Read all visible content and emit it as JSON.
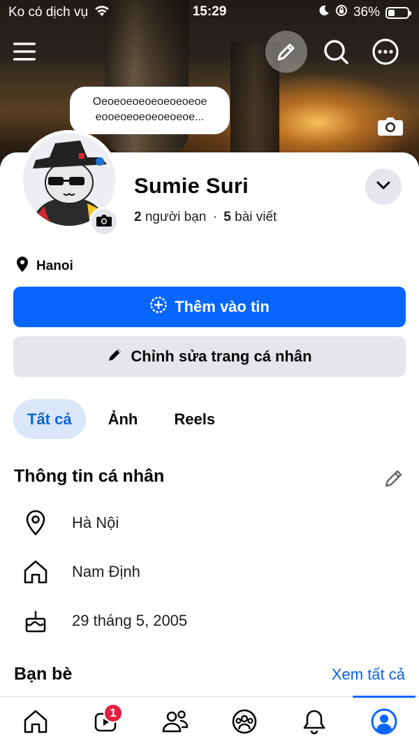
{
  "status_bar": {
    "carrier": "Ko có dịch vụ",
    "time": "15:29",
    "battery_percent_label": "36%",
    "battery_level": 0.36,
    "icons": [
      "wifi-icon",
      "moon-icon",
      "orientation-lock-icon",
      "battery-icon"
    ]
  },
  "header": {
    "icons": [
      "menu-icon",
      "pencil-icon",
      "search-icon",
      "more-icon"
    ]
  },
  "note_bubble": {
    "line1": "Oeoeoeoeoeoeoeoeoe",
    "line2": "eooeoeoeoeoeoeoe..."
  },
  "profile": {
    "name": "Sumie Suri",
    "friends_count": "2",
    "friends_label": "người bạn",
    "separator": "·",
    "posts_count": "5",
    "posts_label": "bài viết",
    "location": "Hanoi"
  },
  "actions": {
    "add_to_story": "Thêm vào tin",
    "edit_profile": "Chỉnh sửa trang cá nhân"
  },
  "tabs": [
    {
      "label": "Tất cả",
      "active": true
    },
    {
      "label": "Ảnh",
      "active": false
    },
    {
      "label": "Reels",
      "active": false
    }
  ],
  "personal_info": {
    "title": "Thông tin cá nhân",
    "rows": [
      {
        "icon": "location-pin-icon",
        "text": "Hà Nội"
      },
      {
        "icon": "home-icon",
        "text": "Nam Định"
      },
      {
        "icon": "birthday-cake-icon",
        "text": "29 tháng 5, 2005"
      }
    ]
  },
  "friends_section": {
    "title": "Bạn bè",
    "see_all": "Xem tất cả"
  },
  "bottom_nav": {
    "items": [
      "home-icon",
      "video-icon",
      "friends-icon",
      "groups-icon",
      "notifications-icon",
      "profile-icon"
    ],
    "video_badge": "1",
    "active": "profile-icon"
  },
  "colors": {
    "accent": "#0866ff",
    "link": "#0a64d7",
    "tab_active_bg": "#dbe7f9",
    "secondary_button": "#e4e6eb",
    "badge": "#e41e3f"
  }
}
